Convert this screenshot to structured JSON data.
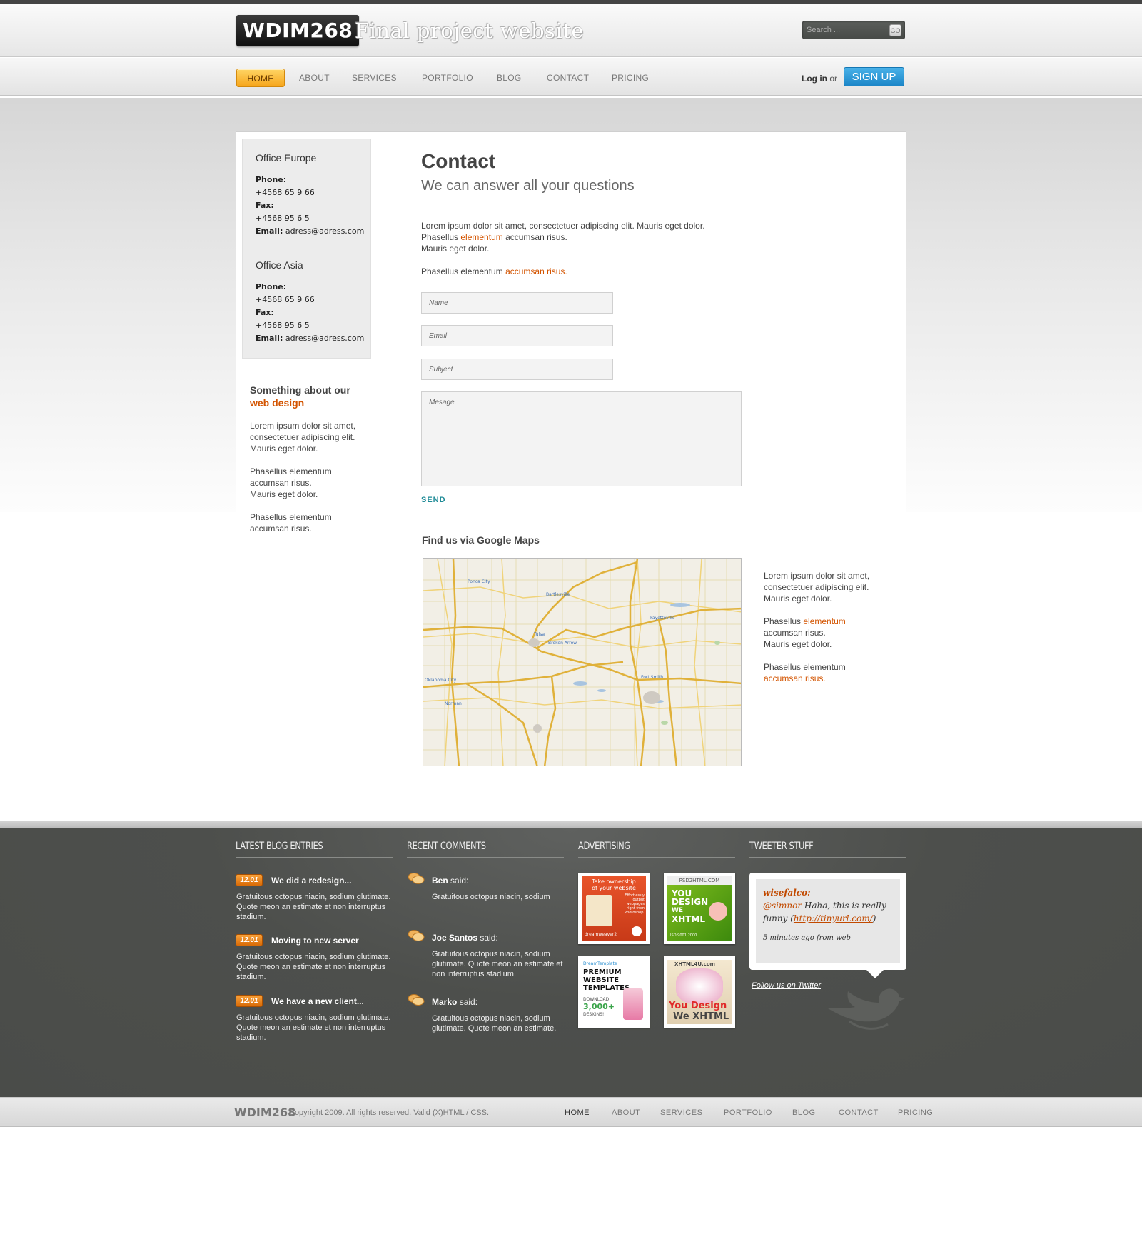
{
  "site": {
    "logo": "WDIM268",
    "tagline": "Final project website"
  },
  "search": {
    "placeholder": "Search ...",
    "go_label": "GO"
  },
  "nav": {
    "items": [
      {
        "label": "HOME",
        "active": true
      },
      {
        "label": "ABOUT"
      },
      {
        "label": "SERVICES"
      },
      {
        "label": "PORTFOLIO"
      },
      {
        "label": "BLOG"
      },
      {
        "label": "CONTACT"
      },
      {
        "label": "PRICING"
      }
    ],
    "login_label": "Log in",
    "or_label": "or",
    "signup_label": "SIGN UP"
  },
  "offices": [
    {
      "title": "Office Europe",
      "phone_label": "Phone:",
      "phone": "+4568 65 9 66",
      "fax_label": "Fax:",
      "fax": "+4568 95 6 5",
      "email_label": "Email:",
      "email": "adress@adress.com"
    },
    {
      "title": "Office Asia",
      "phone_label": "Phone:",
      "phone": "+4568 65 9 66",
      "fax_label": "Fax:",
      "fax": "+4568 95 6 5",
      "email_label": "Email:",
      "email": "adress@adress.com"
    }
  ],
  "sidebar": {
    "title_line1": "Something about our",
    "title_highlight": "web design",
    "para1": [
      "Lorem ipsum dolor sit amet,",
      "consectetuer adipiscing elit.",
      "Mauris eget dolor."
    ],
    "para2": [
      "Phasellus elementum",
      "accumsan risus.",
      "Mauris eget dolor."
    ],
    "para3": [
      "Phasellus elementum",
      "accumsan risus."
    ]
  },
  "contact": {
    "title": "Contact",
    "subtitle": "We can answer all your questions",
    "line1": "Lorem ipsum dolor sit amet, consectetuer adipiscing elit. Mauris eget dolor.",
    "line2_pre": "Phasellus ",
    "line2_link": "elementum",
    "line2_post": " accumsan risus.",
    "line3": "Mauris eget dolor.",
    "line4_pre": "Phasellus elementum ",
    "line4_link": "accumsan risus."
  },
  "form": {
    "name_placeholder": "Name",
    "email_placeholder": "Email",
    "subject_placeholder": "Subject",
    "message_placeholder": "Mesage",
    "send_label": "SEND"
  },
  "maps": {
    "title": "Find us via Google Maps",
    "side_l1": "Lorem ipsum dolor sit amet,",
    "side_l2": "consectetuer adipiscing elit.",
    "side_l3": "Mauris eget dolor.",
    "side_l4_pre": "Phasellus ",
    "side_l4_link": "elementum",
    "side_l5": "accumsan risus.",
    "side_l6": "Mauris eget dolor.",
    "side_l7": "Phasellus elementum",
    "side_l8_link": "accumsan risus.",
    "labels": [
      "Ponca City",
      "Bartlesville",
      "Tulsa",
      "Broken Arrow",
      "Fayetteville",
      "Oklahoma City",
      "Norman",
      "Fort Smith"
    ]
  },
  "footer": {
    "blog_title": "LATEST BLOG ENTRIES",
    "comments_title": "RECENT COMMENTS",
    "ads_title": "ADVERTISING",
    "tweets_title": "TWEETER STUFF",
    "blog": [
      {
        "date": "12.01",
        "title": "We did a redesign...",
        "text": [
          "Gratuitous octopus niacin, sodium glutimate.",
          "Quote meon an estimate et non interruptus",
          "stadium."
        ]
      },
      {
        "date": "12.01",
        "title": "Moving to new server",
        "text": [
          "Gratuitous octopus niacin, sodium glutimate.",
          "Quote meon an estimate et non interruptus",
          "stadium."
        ]
      },
      {
        "date": "12.01",
        "title": "We have a new client...",
        "text": [
          "Gratuitous octopus niacin, sodium glutimate.",
          "Quote meon an estimate et non interruptus",
          "stadium."
        ]
      }
    ],
    "comments": [
      {
        "author": "Ben",
        "said": "said:",
        "text": [
          "Gratuitous octopus niacin, sodium"
        ]
      },
      {
        "author": "Joe Santos",
        "said": "said:",
        "text": [
          "Gratuitous octopus niacin, sodium",
          "glutimate. Quote meon an estimate et",
          "non interruptus stadium."
        ]
      },
      {
        "author": "Marko",
        "said": "said:",
        "text": [
          "Gratuitous octopus niacin, sodium",
          "glutimate. Quote meon an estimate."
        ]
      }
    ],
    "ads": {
      "ad1": [
        "Take ownership",
        "of your website",
        "Effortlessly",
        "output",
        "webpages",
        "right from",
        "Photoshop."
      ],
      "ad1_brand": "dreamweaver2",
      "ad2": [
        "PSD2HTML.COM",
        "YOU",
        "DESIGN",
        "WE",
        "XHTML",
        "ISO 9001:2000"
      ],
      "ad3": [
        "DreamTemplate",
        "PREMIUM",
        "WEBSITE",
        "TEMPLATES",
        "DOWNLOAD",
        "3,000+",
        "DESIGNS!"
      ],
      "ad4": [
        "XHTML4U.com",
        "You Design",
        "We XHTML"
      ]
    },
    "tweet": {
      "user": "wisefalco:",
      "mention": "@simnor",
      "text_mid": " Haha, this is really",
      "text_funny": "funny (",
      "link": "http://tinyurl.com/",
      "text_close": ")",
      "meta": "5 minutes ago from web"
    },
    "follow_label": "Follow us on Twitter"
  },
  "bottom": {
    "logo": "WDIM268",
    "copyright": "Copyright 2009. All rights reserved. Valid (X)HTML / CSS.",
    "nav": [
      "HOME",
      "ABOUT",
      "SERVICES",
      "PORTFOLIO",
      "BLOG",
      "CONTACT",
      "PRICING"
    ]
  },
  "colors": {
    "accent_orange": "#d35400",
    "nav_active": "#f6a51b",
    "signup_blue": "#1c86c8",
    "footer_bg": "#4a4c49",
    "send_teal": "#1d8a96"
  }
}
